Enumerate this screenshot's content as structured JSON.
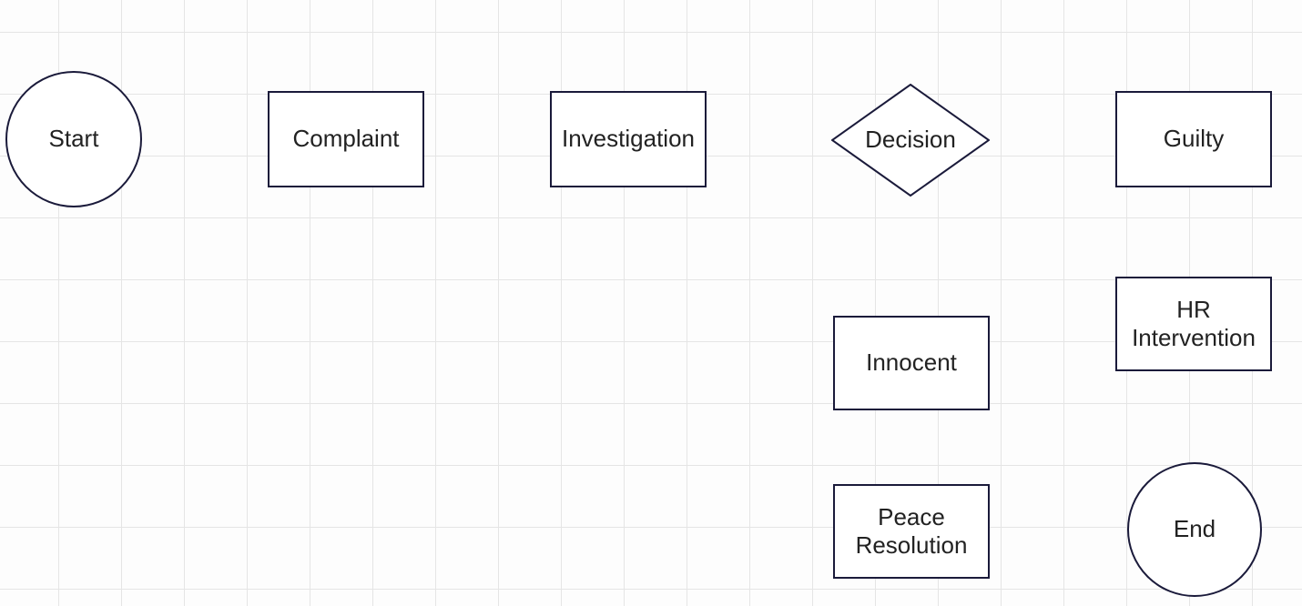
{
  "nodes": {
    "start": {
      "label": "Start",
      "type": "circle"
    },
    "complaint": {
      "label": "Complaint",
      "type": "rect"
    },
    "investigation": {
      "label": "Investigation",
      "type": "rect"
    },
    "decision": {
      "label": "Decision",
      "type": "diamond"
    },
    "guilty": {
      "label": "Guilty",
      "type": "rect"
    },
    "innocent": {
      "label": "Innocent",
      "type": "rect"
    },
    "hr": {
      "label": "HR Intervention",
      "type": "rect"
    },
    "peace": {
      "label": "Peace Resolution",
      "type": "rect"
    },
    "end": {
      "label": "End",
      "type": "circle"
    }
  },
  "chart_data": {
    "type": "flowchart",
    "title": "",
    "nodes": [
      {
        "id": "start",
        "label": "Start",
        "shape": "terminator"
      },
      {
        "id": "complaint",
        "label": "Complaint",
        "shape": "process"
      },
      {
        "id": "investigation",
        "label": "Investigation",
        "shape": "process"
      },
      {
        "id": "decision",
        "label": "Decision",
        "shape": "decision"
      },
      {
        "id": "guilty",
        "label": "Guilty",
        "shape": "process"
      },
      {
        "id": "innocent",
        "label": "Innocent",
        "shape": "process"
      },
      {
        "id": "hr",
        "label": "HR Intervention",
        "shape": "process"
      },
      {
        "id": "peace",
        "label": "Peace Resolution",
        "shape": "process"
      },
      {
        "id": "end",
        "label": "End",
        "shape": "terminator"
      }
    ],
    "edges": []
  }
}
